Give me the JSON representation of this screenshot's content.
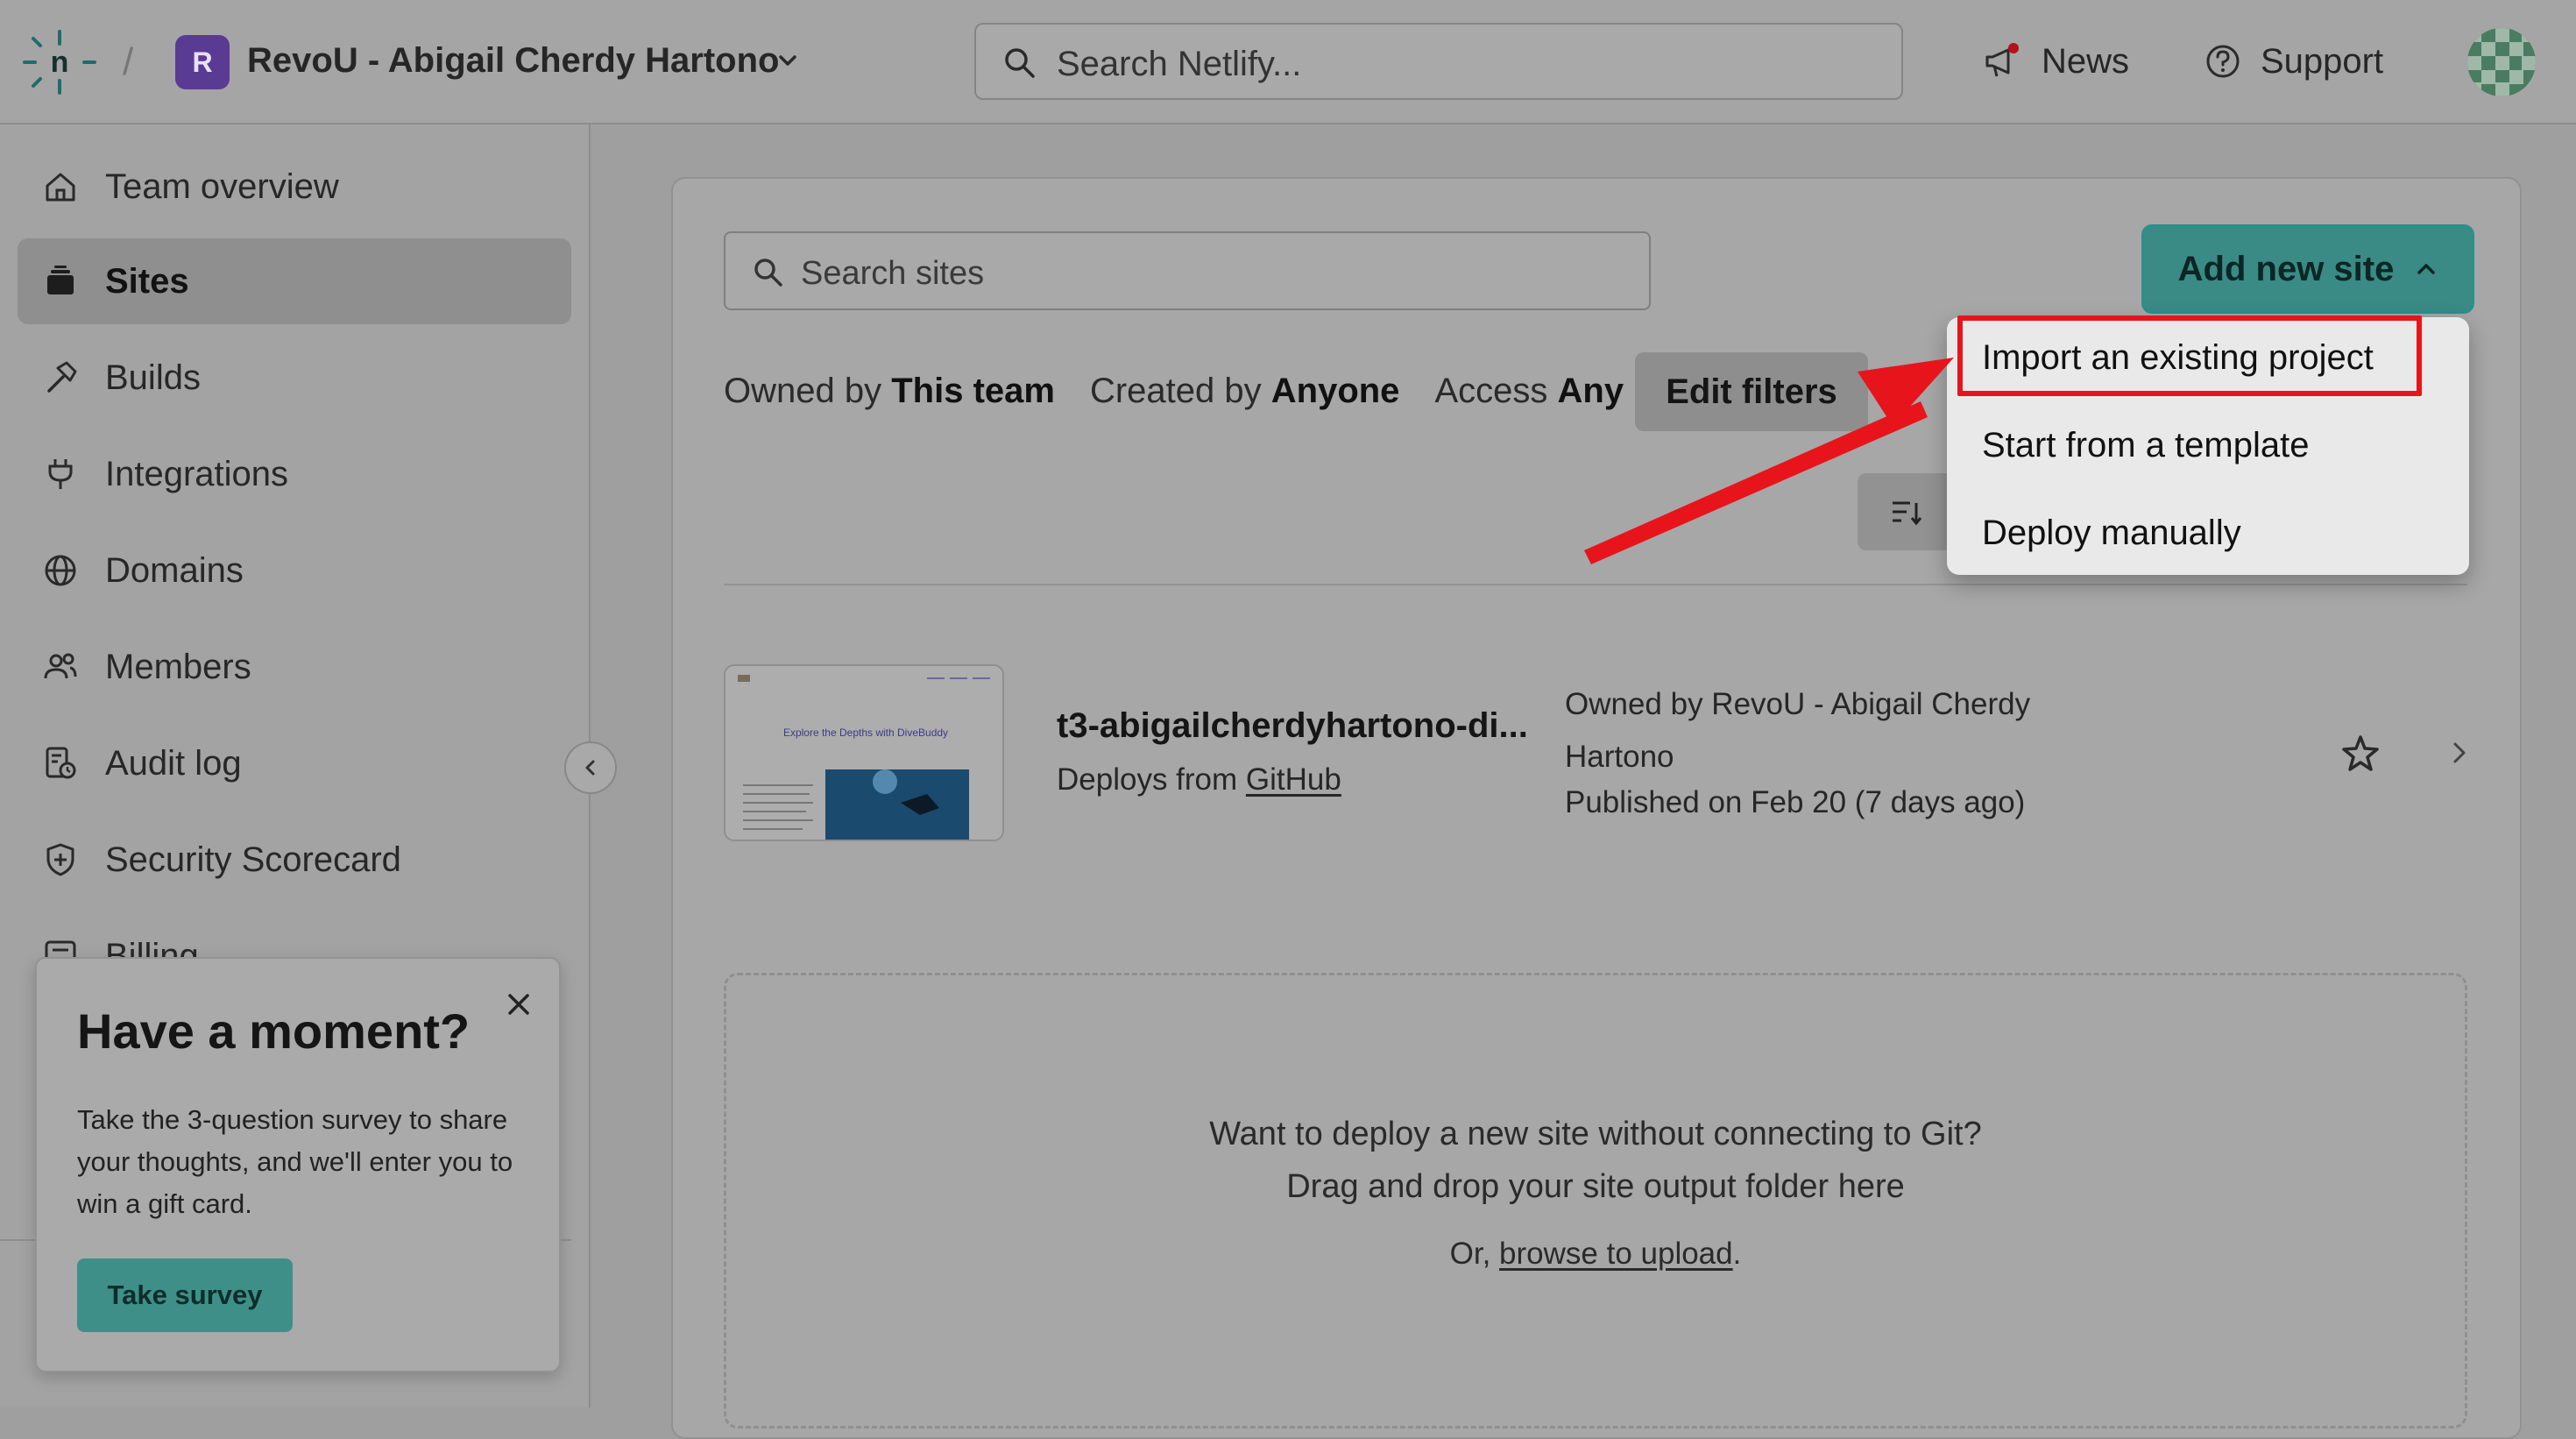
{
  "topbar": {
    "team_initial": "R",
    "team_name": "RevoU - Abigail Cherdy Hartono",
    "search_placeholder": "Search Netlify...",
    "news_label": "News",
    "support_label": "Support"
  },
  "sidebar": {
    "items": [
      {
        "label": "Team overview",
        "icon": "home-icon"
      },
      {
        "label": "Sites",
        "icon": "layers-icon",
        "active": true
      },
      {
        "label": "Builds",
        "icon": "hammer-icon"
      },
      {
        "label": "Integrations",
        "icon": "plug-icon"
      },
      {
        "label": "Domains",
        "icon": "globe-icon"
      },
      {
        "label": "Members",
        "icon": "users-icon"
      },
      {
        "label": "Audit log",
        "icon": "audit-log-icon"
      },
      {
        "label": "Security Scorecard",
        "icon": "shield-icon"
      },
      {
        "label": "Billing",
        "icon": "billing-icon"
      }
    ]
  },
  "survey": {
    "title": "Have a moment?",
    "body": "Take the 3-question survey to share your thoughts, and we'll enter you to win a gift card.",
    "button": "Take survey"
  },
  "main": {
    "search_placeholder": "Search sites",
    "add_site_label": "Add new site",
    "filters": {
      "owned_prefix": "Owned by",
      "owned_value": "This team",
      "created_prefix": "Created by",
      "created_value": "Anyone",
      "access_prefix": "Access",
      "access_value": "Any",
      "edit_label": "Edit filters"
    },
    "menu": [
      "Import an existing project",
      "Start from a template",
      "Deploy manually"
    ],
    "site": {
      "name": "t3-abigailcherdyhartono-di...",
      "deploys_prefix": "Deploys from",
      "deploys_link": "GitHub",
      "owner_line": "Owned by RevoU - Abigail Cherdy Hartono",
      "published": "Published on Feb 20 (7 days ago)",
      "thumb_heading": "Explore the Depths with DiveBuddy"
    },
    "dropzone": {
      "line1": "Want to deploy a new site without connecting to Git?",
      "line2": "Drag and drop your site output folder here",
      "line3_prefix": "Or,",
      "line3_link": "browse to upload",
      "line3_suffix": "."
    }
  },
  "colors": {
    "accent": "#3a8a85",
    "highlight": "#e8141c",
    "team_badge": "#5a3b93"
  }
}
